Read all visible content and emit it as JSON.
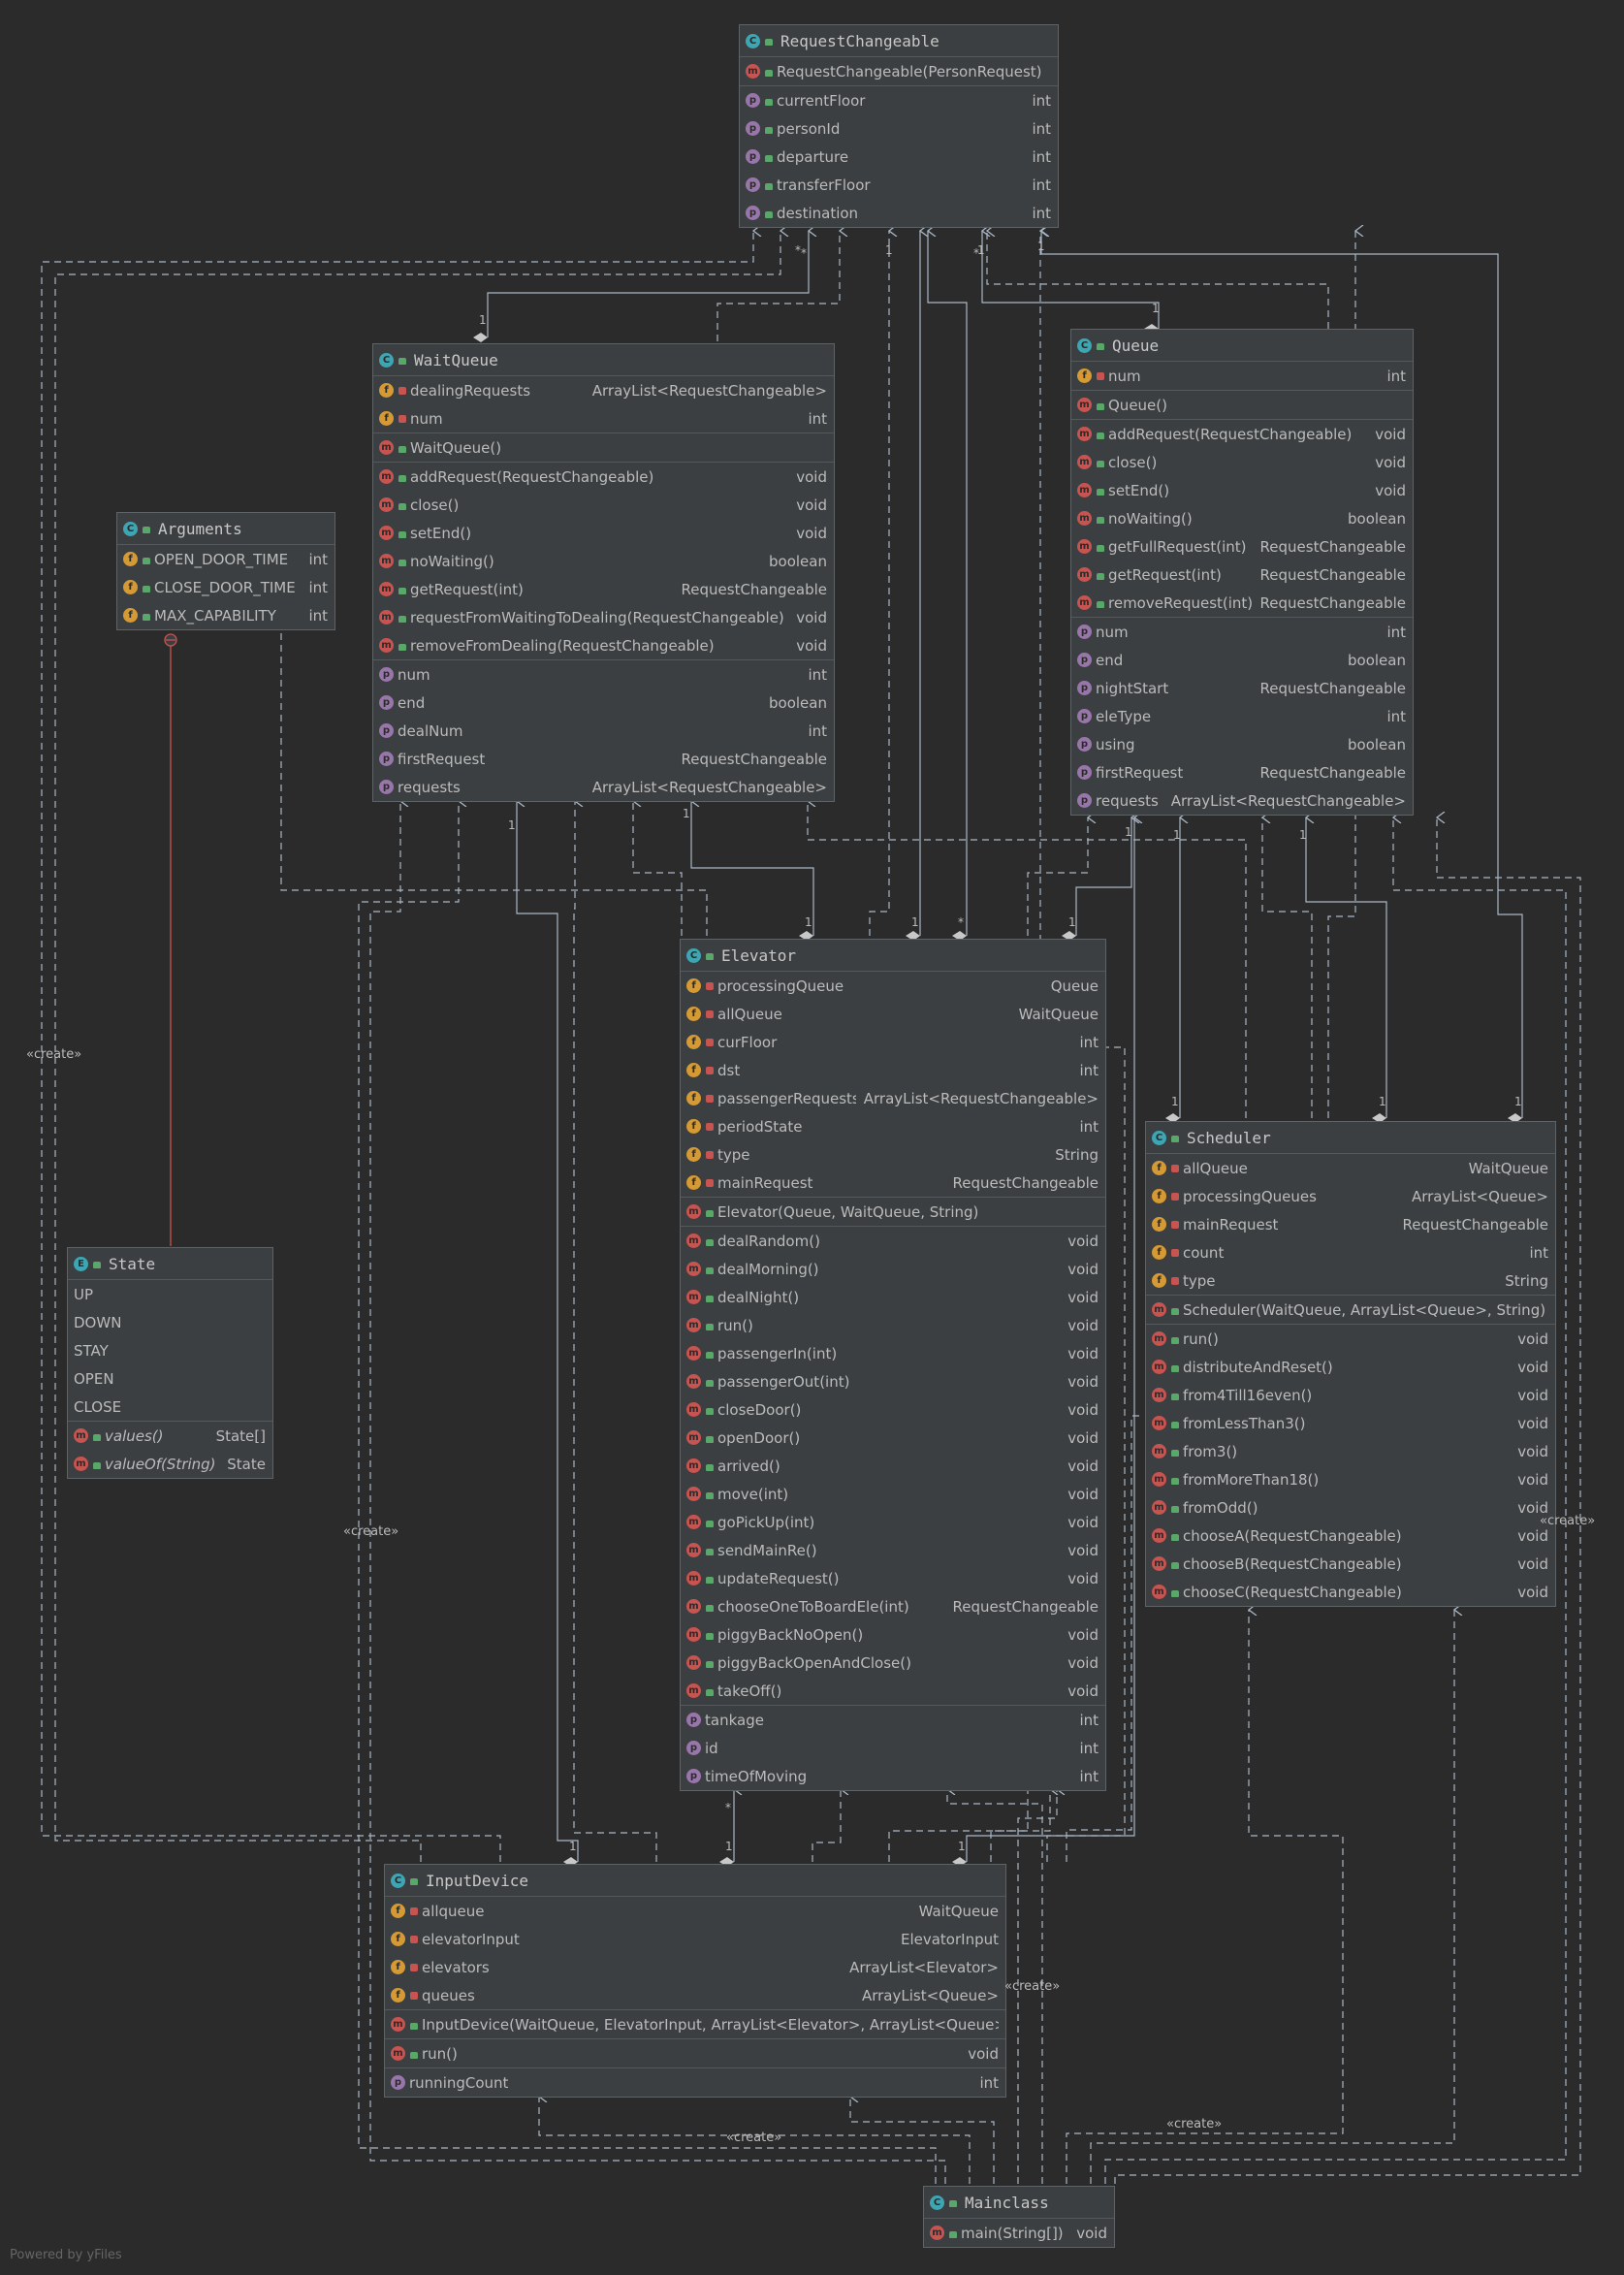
{
  "footer": "Powered by yFiles",
  "edge_labels": {
    "create": "«create»"
  },
  "icons": {
    "class": "C",
    "enum": "E",
    "method": "m",
    "field": "f",
    "property": "p"
  },
  "colors": {
    "background": "#2b2b2b",
    "node": "#3c3f41",
    "edge": "#a9b7c6",
    "inner_edge": "#c75450"
  },
  "classes": {
    "RequestChangeable": {
      "name": "RequestChangeable",
      "kind": "class",
      "sections": [
        [
          {
            "k": "m",
            "v": "pub",
            "n": "RequestChangeable(PersonRequest)",
            "t": ""
          }
        ],
        [
          {
            "k": "p",
            "v": "pub",
            "n": "currentFloor",
            "t": "int"
          },
          {
            "k": "p",
            "v": "pub",
            "n": "personId",
            "t": "int"
          },
          {
            "k": "p",
            "v": "pub",
            "n": "departure",
            "t": "int"
          },
          {
            "k": "p",
            "v": "pub",
            "n": "transferFloor",
            "t": "int"
          },
          {
            "k": "p",
            "v": "pub",
            "n": "destination",
            "t": "int"
          }
        ]
      ]
    },
    "WaitQueue": {
      "name": "WaitQueue",
      "kind": "class",
      "sections": [
        [
          {
            "k": "f",
            "v": "pri",
            "n": "dealingRequests",
            "t": "ArrayList<RequestChangeable>"
          },
          {
            "k": "f",
            "v": "pri",
            "n": "num",
            "t": "int"
          }
        ],
        [
          {
            "k": "m",
            "v": "pub",
            "n": "WaitQueue()",
            "t": ""
          }
        ],
        [
          {
            "k": "m",
            "v": "pub",
            "n": "addRequest(RequestChangeable)",
            "t": "void"
          },
          {
            "k": "m",
            "v": "pub",
            "n": "close()",
            "t": "void"
          },
          {
            "k": "m",
            "v": "pub",
            "n": "setEnd()",
            "t": "void"
          },
          {
            "k": "m",
            "v": "pub",
            "n": "noWaiting()",
            "t": "boolean"
          },
          {
            "k": "m",
            "v": "pub",
            "n": "getRequest(int)",
            "t": "RequestChangeable"
          },
          {
            "k": "m",
            "v": "pub",
            "n": "requestFromWaitingToDealing(RequestChangeable)",
            "t": "void"
          },
          {
            "k": "m",
            "v": "pub",
            "n": "removeFromDealing(RequestChangeable)",
            "t": "void"
          }
        ],
        [
          {
            "k": "p",
            "v": "",
            "n": "num",
            "t": "int"
          },
          {
            "k": "p",
            "v": "",
            "n": "end",
            "t": "boolean"
          },
          {
            "k": "p",
            "v": "",
            "n": "dealNum",
            "t": "int"
          },
          {
            "k": "p",
            "v": "",
            "n": "firstRequest",
            "t": "RequestChangeable"
          },
          {
            "k": "p",
            "v": "",
            "n": "requests",
            "t": "ArrayList<RequestChangeable>"
          }
        ]
      ]
    },
    "Queue": {
      "name": "Queue",
      "kind": "class",
      "sections": [
        [
          {
            "k": "f",
            "v": "pri",
            "n": "num",
            "t": "int"
          }
        ],
        [
          {
            "k": "m",
            "v": "pub",
            "n": "Queue()",
            "t": ""
          }
        ],
        [
          {
            "k": "m",
            "v": "pub",
            "n": "addRequest(RequestChangeable)",
            "t": "void"
          },
          {
            "k": "m",
            "v": "pub",
            "n": "close()",
            "t": "void"
          },
          {
            "k": "m",
            "v": "pub",
            "n": "setEnd()",
            "t": "void"
          },
          {
            "k": "m",
            "v": "pub",
            "n": "noWaiting()",
            "t": "boolean"
          },
          {
            "k": "m",
            "v": "pub",
            "n": "getFullRequest(int)",
            "t": "RequestChangeable"
          },
          {
            "k": "m",
            "v": "pub",
            "n": "getRequest(int)",
            "t": "RequestChangeable"
          },
          {
            "k": "m",
            "v": "pub",
            "n": "removeRequest(int)",
            "t": "RequestChangeable"
          }
        ],
        [
          {
            "k": "p",
            "v": "",
            "n": "num",
            "t": "int"
          },
          {
            "k": "p",
            "v": "",
            "n": "end",
            "t": "boolean"
          },
          {
            "k": "p",
            "v": "",
            "n": "nightStart",
            "t": "RequestChangeable"
          },
          {
            "k": "p",
            "v": "",
            "n": "eleType",
            "t": "int"
          },
          {
            "k": "p",
            "v": "",
            "n": "using",
            "t": "boolean"
          },
          {
            "k": "p",
            "v": "",
            "n": "firstRequest",
            "t": "RequestChangeable"
          },
          {
            "k": "p",
            "v": "",
            "n": "requests",
            "t": "ArrayList<RequestChangeable>"
          }
        ]
      ]
    },
    "Arguments": {
      "name": "Arguments",
      "kind": "class",
      "sections": [
        [
          {
            "k": "f",
            "v": "pub",
            "n": "OPEN_DOOR_TIME",
            "t": "int"
          },
          {
            "k": "f",
            "v": "pub",
            "n": "CLOSE_DOOR_TIME",
            "t": "int"
          },
          {
            "k": "f",
            "v": "pub",
            "n": "MAX_CAPABILITY",
            "t": "int"
          }
        ]
      ]
    },
    "Elevator": {
      "name": "Elevator",
      "kind": "class",
      "sections": [
        [
          {
            "k": "f",
            "v": "pri",
            "n": "processingQueue",
            "t": "Queue"
          },
          {
            "k": "f",
            "v": "pri",
            "n": "allQueue",
            "t": "WaitQueue"
          },
          {
            "k": "f",
            "v": "pri",
            "n": "curFloor",
            "t": "int"
          },
          {
            "k": "f",
            "v": "pri",
            "n": "dst",
            "t": "int"
          },
          {
            "k": "f",
            "v": "pri",
            "n": "passengerRequests",
            "t": "ArrayList<RequestChangeable>"
          },
          {
            "k": "f",
            "v": "pri",
            "n": "periodState",
            "t": "int"
          },
          {
            "k": "f",
            "v": "pri",
            "n": "type",
            "t": "String"
          },
          {
            "k": "f",
            "v": "pri",
            "n": "mainRequest",
            "t": "RequestChangeable"
          }
        ],
        [
          {
            "k": "m",
            "v": "pub",
            "n": "Elevator(Queue, WaitQueue, String)",
            "t": ""
          }
        ],
        [
          {
            "k": "m",
            "v": "pub",
            "n": "dealRandom()",
            "t": "void"
          },
          {
            "k": "m",
            "v": "pub",
            "n": "dealMorning()",
            "t": "void"
          },
          {
            "k": "m",
            "v": "pub",
            "n": "dealNight()",
            "t": "void"
          },
          {
            "k": "m",
            "v": "pub",
            "n": "run()",
            "t": "void"
          },
          {
            "k": "m",
            "v": "pub",
            "n": "passengerIn(int)",
            "t": "void"
          },
          {
            "k": "m",
            "v": "pub",
            "n": "passengerOut(int)",
            "t": "void"
          },
          {
            "k": "m",
            "v": "pub",
            "n": "closeDoor()",
            "t": "void"
          },
          {
            "k": "m",
            "v": "pub",
            "n": "openDoor()",
            "t": "void"
          },
          {
            "k": "m",
            "v": "pub",
            "n": "arrived()",
            "t": "void"
          },
          {
            "k": "m",
            "v": "pub",
            "n": "move(int)",
            "t": "void"
          },
          {
            "k": "m",
            "v": "pub",
            "n": "goPickUp(int)",
            "t": "void"
          },
          {
            "k": "m",
            "v": "pub",
            "n": "sendMainRe()",
            "t": "void"
          },
          {
            "k": "m",
            "v": "pub",
            "n": "updateRequest()",
            "t": "void"
          },
          {
            "k": "m",
            "v": "pub",
            "n": "chooseOneToBoardEle(int)",
            "t": "RequestChangeable"
          },
          {
            "k": "m",
            "v": "pub",
            "n": "piggyBackNoOpen()",
            "t": "void"
          },
          {
            "k": "m",
            "v": "pub",
            "n": "piggyBackOpenAndClose()",
            "t": "void"
          },
          {
            "k": "m",
            "v": "pub",
            "n": "takeOff()",
            "t": "void"
          }
        ],
        [
          {
            "k": "p",
            "v": "",
            "n": "tankage",
            "t": "int"
          },
          {
            "k": "p",
            "v": "",
            "n": "id",
            "t": "int"
          },
          {
            "k": "p",
            "v": "",
            "n": "timeOfMoving",
            "t": "int"
          }
        ]
      ]
    },
    "Scheduler": {
      "name": "Scheduler",
      "kind": "class",
      "sections": [
        [
          {
            "k": "f",
            "v": "pri",
            "n": "allQueue",
            "t": "WaitQueue"
          },
          {
            "k": "f",
            "v": "pri",
            "n": "processingQueues",
            "t": "ArrayList<Queue>"
          },
          {
            "k": "f",
            "v": "pri",
            "n": "mainRequest",
            "t": "RequestChangeable"
          },
          {
            "k": "f",
            "v": "pri",
            "n": "count",
            "t": "int"
          },
          {
            "k": "f",
            "v": "pri",
            "n": "type",
            "t": "String"
          }
        ],
        [
          {
            "k": "m",
            "v": "pub",
            "n": "Scheduler(WaitQueue, ArrayList<Queue>, String)",
            "t": ""
          }
        ],
        [
          {
            "k": "m",
            "v": "pub",
            "n": "run()",
            "t": "void"
          },
          {
            "k": "m",
            "v": "pub",
            "n": "distributeAndReset()",
            "t": "void"
          },
          {
            "k": "m",
            "v": "pub",
            "n": "from4Till16even()",
            "t": "void"
          },
          {
            "k": "m",
            "v": "pub",
            "n": "fromLessThan3()",
            "t": "void"
          },
          {
            "k": "m",
            "v": "pub",
            "n": "from3()",
            "t": "void"
          },
          {
            "k": "m",
            "v": "pub",
            "n": "fromMoreThan18()",
            "t": "void"
          },
          {
            "k": "m",
            "v": "pub",
            "n": "fromOdd()",
            "t": "void"
          },
          {
            "k": "m",
            "v": "pub",
            "n": "chooseA(RequestChangeable)",
            "t": "void"
          },
          {
            "k": "m",
            "v": "pub",
            "n": "chooseB(RequestChangeable)",
            "t": "void"
          },
          {
            "k": "m",
            "v": "pub",
            "n": "chooseC(RequestChangeable)",
            "t": "void"
          }
        ]
      ]
    },
    "State": {
      "name": "State",
      "kind": "enum",
      "sections": [
        [
          {
            "k": "",
            "v": "",
            "n": "UP",
            "t": ""
          },
          {
            "k": "",
            "v": "",
            "n": "DOWN",
            "t": ""
          },
          {
            "k": "",
            "v": "",
            "n": "STAY",
            "t": ""
          },
          {
            "k": "",
            "v": "",
            "n": "OPEN",
            "t": ""
          },
          {
            "k": "",
            "v": "",
            "n": "CLOSE",
            "t": ""
          }
        ],
        [
          {
            "k": "m",
            "v": "pub",
            "n": "values()",
            "t": "State[]",
            "i": true
          },
          {
            "k": "m",
            "v": "pub",
            "n": "valueOf(String)",
            "t": "State",
            "i": true
          }
        ]
      ]
    },
    "InputDevice": {
      "name": "InputDevice",
      "kind": "class",
      "sections": [
        [
          {
            "k": "f",
            "v": "pri",
            "n": "allqueue",
            "t": "WaitQueue"
          },
          {
            "k": "f",
            "v": "pri",
            "n": "elevatorInput",
            "t": "ElevatorInput"
          },
          {
            "k": "f",
            "v": "pri",
            "n": "elevators",
            "t": "ArrayList<Elevator>"
          },
          {
            "k": "f",
            "v": "pri",
            "n": "queues",
            "t": "ArrayList<Queue>"
          }
        ],
        [
          {
            "k": "m",
            "v": "pub",
            "n": "InputDevice(WaitQueue, ElevatorInput, ArrayList<Elevator>, ArrayList<Queue>)",
            "t": ""
          }
        ],
        [
          {
            "k": "m",
            "v": "pub",
            "n": "run()",
            "t": "void"
          }
        ],
        [
          {
            "k": "p",
            "v": "",
            "n": "runningCount",
            "t": "int"
          }
        ]
      ]
    },
    "Mainclass": {
      "name": "Mainclass",
      "kind": "class",
      "sections": [
        [
          {
            "k": "m",
            "v": "pub",
            "n": "main(String[])",
            "t": "void"
          }
        ]
      ]
    }
  },
  "multiplicities": [
    "1",
    "*",
    "1",
    "*",
    "1",
    "*",
    "1",
    "1",
    "1",
    "1",
    "1",
    "1",
    "1",
    "1",
    "1",
    "1",
    "1",
    "1",
    "1",
    "1",
    "*",
    "1",
    "*",
    "1"
  ]
}
